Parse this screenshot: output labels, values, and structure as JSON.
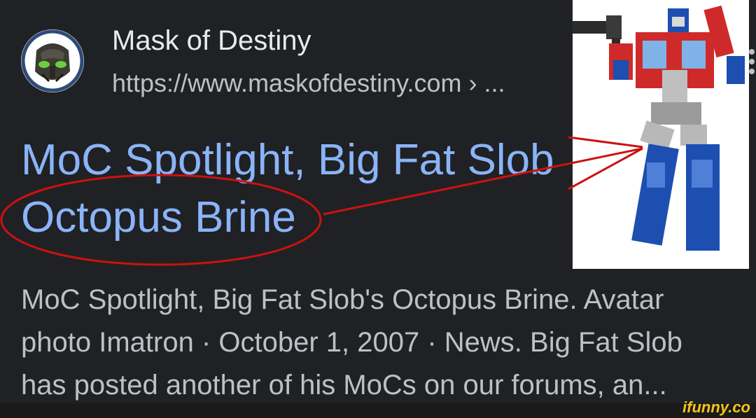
{
  "result": {
    "site_name": "Mask of Destiny",
    "site_url": "https://www.maskofdestiny.com › ...",
    "title_line1": "MoC Spotlight, Big Fat Slob",
    "title_line2": "Octopus Brine",
    "snippet_line1": "MoC Spotlight, Big Fat Slob's Octopus Brine. Avatar",
    "snippet_line2": "photo Imatron · October 1, 2007 · News. Big Fat Slob",
    "snippet_line3": "has posted another of his MoCs on our forums, an..."
  },
  "icons": {
    "favicon": "bionicle-mask-icon",
    "more": "more-vert-icon"
  },
  "annotation": {
    "color": "#cc1111"
  },
  "watermark": {
    "text": "ifunny.co"
  },
  "colors": {
    "background": "#202124",
    "title": "#8ab4f8",
    "site_name": "#e8eaed",
    "snippet": "#bdc1c6",
    "annotation": "#cc1111"
  }
}
